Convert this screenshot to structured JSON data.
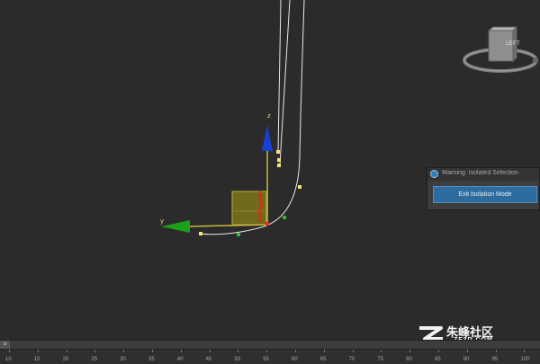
{
  "viewport": {
    "axis_x_label": "y",
    "axis_z_label": "z"
  },
  "viewcube": {
    "face_label": "LEFT"
  },
  "isolation_dialog": {
    "title": "Warning: Isolated Selection",
    "exit_button_label": "Exit Isolation Mode"
  },
  "watermark": {
    "title": "朱峰社区",
    "domain": "ZF3D.COM"
  },
  "timeline": {
    "arrow_glyph": ">",
    "ticks": [
      "10",
      "15",
      "20",
      "25",
      "30",
      "35",
      "40",
      "45",
      "50",
      "55",
      "60",
      "65",
      "70",
      "75",
      "80",
      "85",
      "90",
      "95",
      "100"
    ]
  },
  "colors": {
    "background": "#2b2b2b",
    "spline": "#e8e8e8",
    "vertex": "#f3e57a",
    "gizmo_z": "#1a3fd6",
    "gizmo_y": "#1aa01a",
    "box_fill": "#6f6a1c",
    "dialog_button": "#2e6b9e"
  }
}
